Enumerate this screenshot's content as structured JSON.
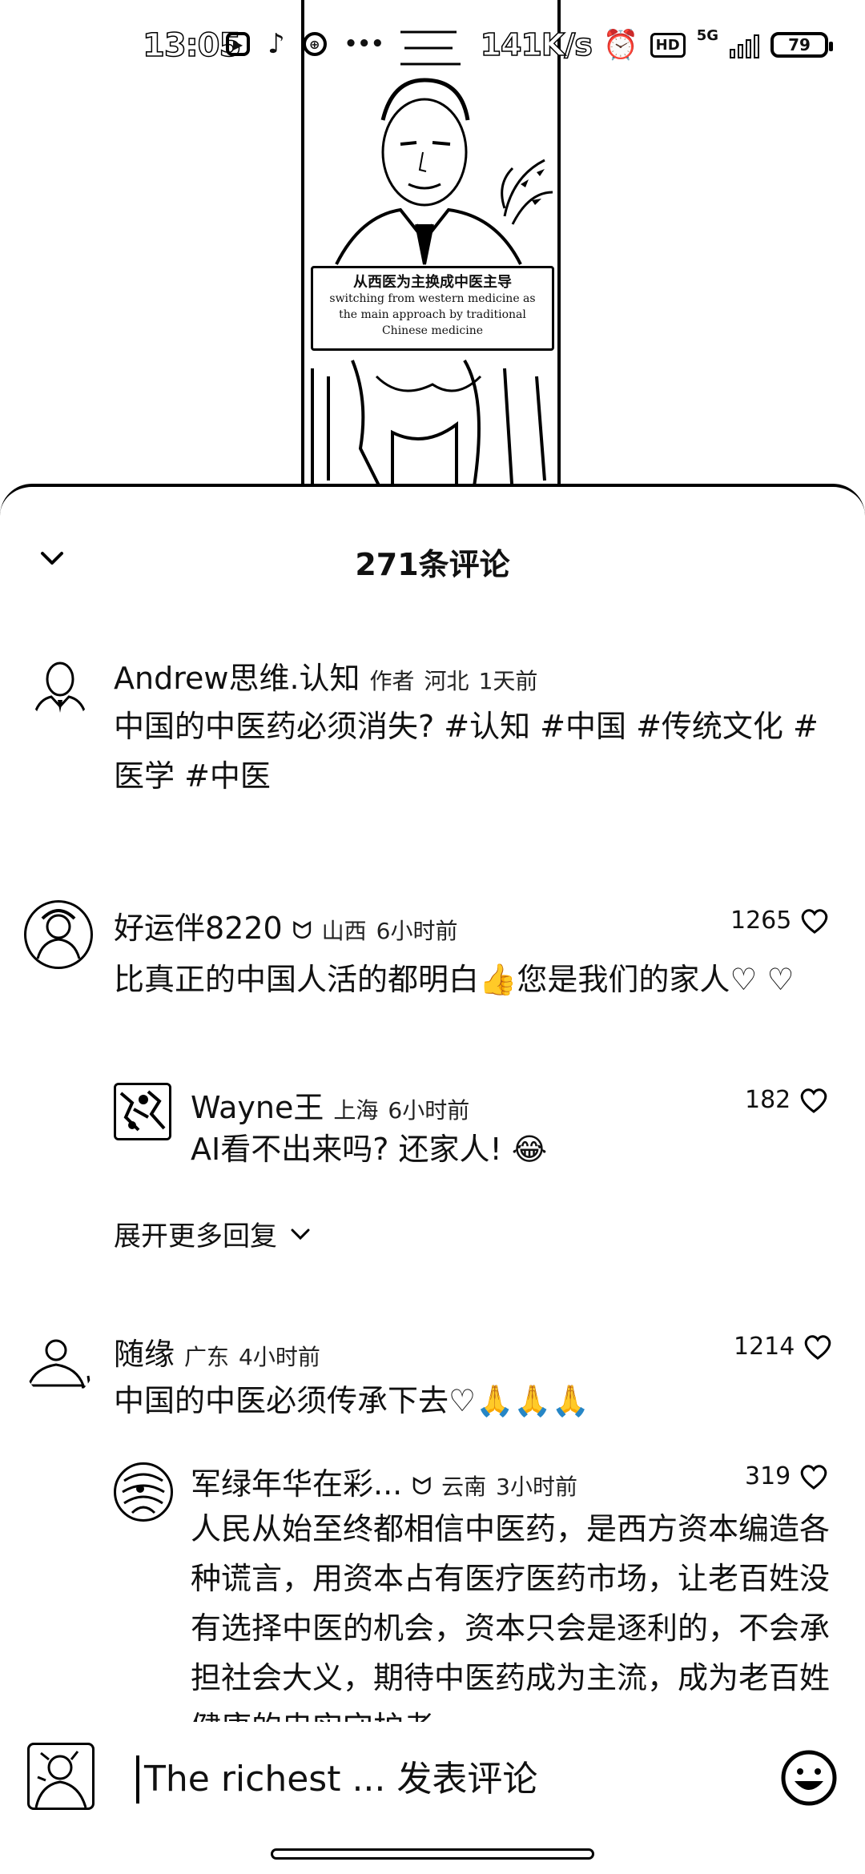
{
  "status_bar": {
    "time": "13:05",
    "net_speed": "141K/s",
    "battery": "79",
    "hd": "HD",
    "network": "5G",
    "more_dots": "•••"
  },
  "video": {
    "subtitle_zh": "从西医为主换成中医主导",
    "subtitle_en_1": "switching from western medicine as",
    "subtitle_en_2": "the main approach by traditional",
    "subtitle_en_3": "Chinese medicine"
  },
  "sheet": {
    "title": "271条评论",
    "expand_more": "展开更多回复"
  },
  "comments": [
    {
      "name": "Andrew思维.认知",
      "tag": "作者",
      "location": "河北",
      "time": "1天前",
      "text": "中国的中医药必须消失? #认知 #中国 #传统文化 #医学 #中医"
    },
    {
      "name": "好运伴8220",
      "location": "山西",
      "time": "6小时前",
      "likes": "1265",
      "text": "比真正的中国人活的都明白👍您是我们的家人♡ ♡"
    },
    {
      "name": "Wayne王",
      "location": "上海",
      "time": "6小时前",
      "likes": "182",
      "text": "AI看不出来吗? 还家人! 😂"
    },
    {
      "name": "随缘",
      "location": "广东",
      "time": "4小时前",
      "likes": "1214",
      "text": "中国的中医必须传承下去♡🙏🙏🙏"
    },
    {
      "name": "军绿年华在彩...",
      "location": "云南",
      "time": "3小时前",
      "likes": "319",
      "text": "人民从始至终都相信中医药，是西方资本编造各种谎言，用资本占有医疗医药市场，让老百姓没有选择中医的机会，资本只会是逐利的，不会承担社会大义，期待中医药成为主流，成为老百姓健康的忠实守护者"
    }
  ],
  "input": {
    "placeholder": "The richest ... 发表评论"
  },
  "icons": {
    "collapse": "chevron-down-icon",
    "like": "heart-icon",
    "emoji": "smiley-icon",
    "badge": "fan-badge-icon"
  }
}
